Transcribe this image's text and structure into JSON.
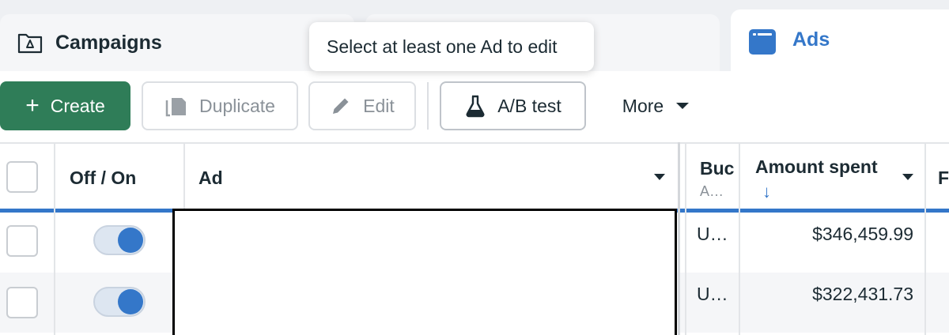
{
  "tabs": {
    "campaigns": "Campaigns",
    "ads": "Ads"
  },
  "tooltip": "Select at least one Ad to edit",
  "toolbar": {
    "create_plus": "+",
    "create_label": "Create",
    "duplicate_label": "Duplicate",
    "edit_label": "Edit",
    "ab_test_label": "A/B test",
    "more_label": "More"
  },
  "table": {
    "columns": {
      "toggle": "Off / On",
      "ad": "Ad",
      "budget": "Buc",
      "budget_sub": "A…",
      "amount_spent": "Amount spent",
      "amount_sort": "↓",
      "next_partial": "F"
    },
    "rows": [
      {
        "budget": "U…",
        "amount_spent": "$346,459.99",
        "toggle_on": true
      },
      {
        "budget": "U…",
        "amount_spent": "$322,431.73",
        "toggle_on": true
      }
    ]
  },
  "colors": {
    "accent": "#3477c9",
    "create_green": "#2f7d58",
    "text": "#1c2b33"
  }
}
